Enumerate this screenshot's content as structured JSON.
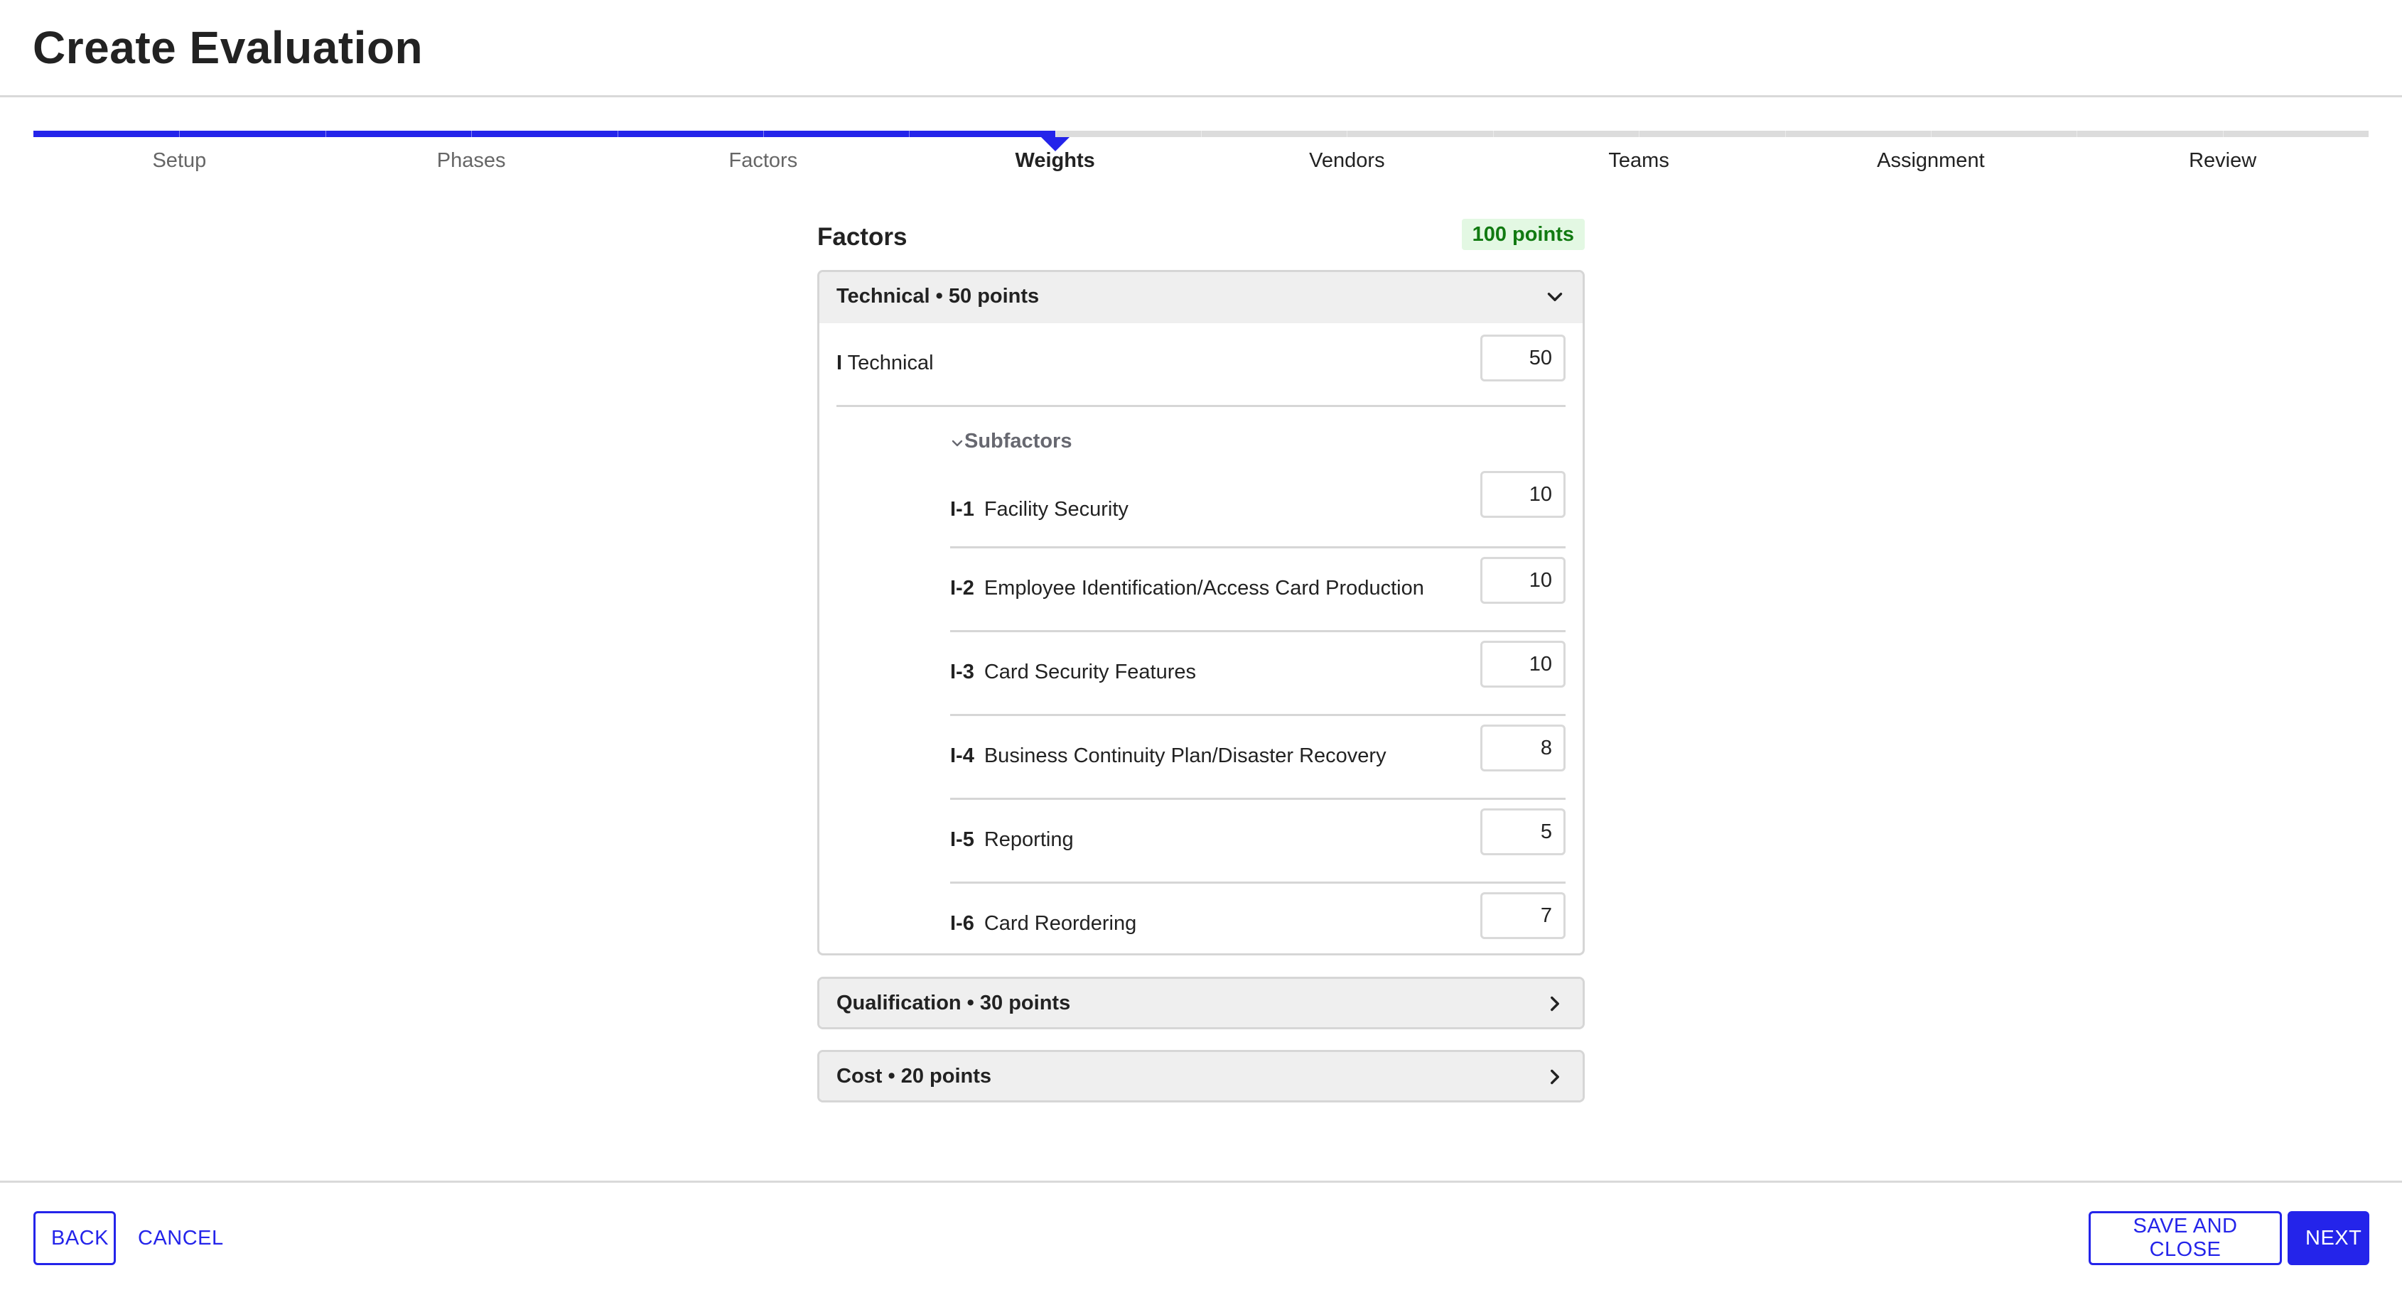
{
  "page": {
    "title": "Create Evaluation"
  },
  "stepper": {
    "steps": [
      {
        "label": "Setup",
        "state": "done"
      },
      {
        "label": "Phases",
        "state": "done"
      },
      {
        "label": "Factors",
        "state": "done"
      },
      {
        "label": "Weights",
        "state": "active"
      },
      {
        "label": "Vendors",
        "state": "upcoming"
      },
      {
        "label": "Teams",
        "state": "upcoming"
      },
      {
        "label": "Assignment",
        "state": "upcoming"
      },
      {
        "label": "Review",
        "state": "upcoming"
      }
    ],
    "active_index": 3,
    "accent_color": "#2424ea"
  },
  "factors_panel": {
    "title": "Factors",
    "total_badge": "100 points",
    "sections": [
      {
        "header": "Technical • 50 points",
        "expanded": true,
        "chevron": "chevron-down-icon",
        "factor": {
          "code": "I",
          "name": "Technical",
          "value": "50"
        },
        "subfactors_label": "Subfactors",
        "subfactors": [
          {
            "code": "I-1",
            "name": "Facility Security",
            "value": "10"
          },
          {
            "code": "I-2",
            "name": "Employee Identification/Access Card Production",
            "value": "10"
          },
          {
            "code": "I-3",
            "name": "Card Security Features",
            "value": "10"
          },
          {
            "code": "I-4",
            "name": "Business Continuity Plan/Disaster Recovery",
            "value": "8"
          },
          {
            "code": "I-5",
            "name": "Reporting",
            "value": "5"
          },
          {
            "code": "I-6",
            "name": "Card Reordering",
            "value": "7"
          }
        ]
      },
      {
        "header": "Qualification • 30 points",
        "expanded": false,
        "chevron": "chevron-right-icon"
      },
      {
        "header": "Cost • 20 points",
        "expanded": false,
        "chevron": "chevron-right-icon"
      }
    ]
  },
  "footer": {
    "back_label": "BACK",
    "cancel_label": "CANCEL",
    "save_close_label": "SAVE AND CLOSE",
    "next_label": "NEXT"
  }
}
